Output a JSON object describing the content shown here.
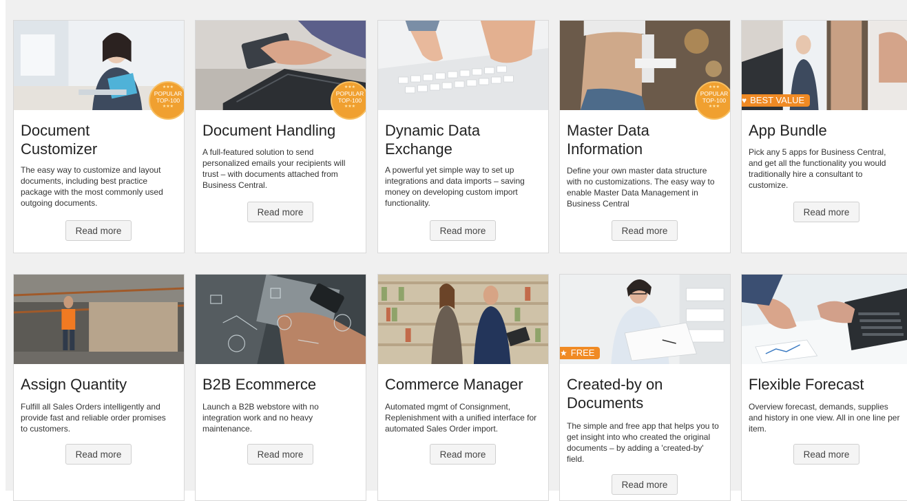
{
  "cards": [
    {
      "title": "Document Customizer",
      "title_lines": [
        "Document",
        "Customizer"
      ],
      "description": "The easy way to customize and layout documents, including best practice package with the most commonly used outgoing documents.",
      "button": "Read more",
      "badge": "POPULAR TOP-100"
    },
    {
      "title": "Document Handling",
      "description": "A full-featured solution to send personalized emails your recipients will trust – with documents attached from Business Central.",
      "button": "Read more",
      "badge": "POPULAR TOP-100"
    },
    {
      "title": "Dynamic Data Exchange",
      "title_lines": [
        "Dynamic Data",
        "Exchange"
      ],
      "description": "A powerful yet simple way to set up integrations and data imports – saving money on developing custom import functionality.",
      "button": "Read more"
    },
    {
      "title": "Master Data Information",
      "title_lines": [
        "Master Data",
        "Information"
      ],
      "description": "Define your own master data structure with no customizations. The easy way to enable Master Data Management in Business Central",
      "button": "Read more",
      "badge": "POPULAR TOP-100"
    },
    {
      "title": "App Bundle",
      "description": "Pick any 5 apps for Business Central, and get all the functionality you would traditionally hire a consultant to customize.",
      "button": "Read more",
      "ribbon": "BEST VALUE"
    },
    {
      "title": "Assign Quantity",
      "description": "Fulfill all Sales Orders intelligently and provide fast and reliable order promises to customers.",
      "button": "Read more"
    },
    {
      "title": "B2B Ecommerce",
      "description": "Launch a B2B webstore with no integration work and no heavy maintenance.",
      "button": "Read more"
    },
    {
      "title": "Commerce Manager",
      "description": "Automated mgmt of Consignment, Replenishment with a unified interface for automated Sales Order import.",
      "button": "Read more"
    },
    {
      "title": "Created-by on Documents",
      "title_lines": [
        "Created-by on",
        "Documents"
      ],
      "description": "The simple and free app that helps you to get insight into who created the original documents – by adding a 'created-by' field.",
      "button": "Read more",
      "ribbon": "FREE"
    },
    {
      "title": "Flexible Forecast",
      "description": "Overview forecast, demands, supplies and history in one view. All in one line per item.",
      "button": "Read more"
    }
  ],
  "colors": {
    "badge": "#f0a030",
    "ribbon": "#f08a24",
    "page_background": "#f0f0f0"
  },
  "icons": {
    "best_value": "heart-icon",
    "free": "star-icon"
  }
}
